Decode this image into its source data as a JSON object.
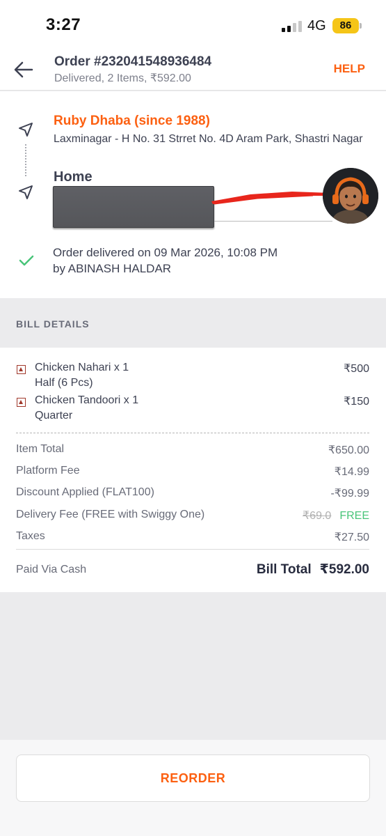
{
  "status_bar": {
    "time": "3:27",
    "network": "4G",
    "battery": "86"
  },
  "header": {
    "order_title": "Order #232041548936484",
    "order_subtitle": "Delivered, 2 Items, ₹592.00",
    "help_label": "HELP"
  },
  "route": {
    "restaurant_name": "Ruby Dhaba (since 1988)",
    "restaurant_address": "Laxminagar - H No. 31 Strret No. 4D Aram Park, Shastri Nagar",
    "home_label": "Home",
    "delivered_line1": "Order delivered on 09 Mar 2026, 10:08 PM",
    "delivered_line2": "by ABINASH HALDAR"
  },
  "bill": {
    "heading": "BILL DETAILS",
    "items": [
      {
        "name": "Chicken Nahari x 1",
        "variant": "Half (6 Pcs)",
        "price": "₹500"
      },
      {
        "name": "Chicken Tandoori x 1",
        "variant": "Quarter",
        "price": "₹150"
      }
    ],
    "item_total_label": "Item Total",
    "item_total": "₹650.00",
    "platform_fee_label": "Platform Fee",
    "platform_fee": "₹14.99",
    "discount_label": "Discount Applied (FLAT100)",
    "discount": "-₹99.99",
    "delivery_label": "Delivery Fee (FREE with Swiggy One)",
    "delivery_original": "₹69.0",
    "delivery_free": "FREE",
    "taxes_label": "Taxes",
    "taxes": "₹27.50",
    "paid_via": "Paid Via Cash",
    "bill_total_label": "Bill Total",
    "bill_total": "₹592.00"
  },
  "reorder_label": "REORDER",
  "colors": {
    "accent": "#fc6011",
    "success": "#48c479",
    "battery": "#f5c518"
  },
  "icons": [
    "signal-icon",
    "back-arrow-icon",
    "navigation-icon",
    "check-icon",
    "non-veg-icon"
  ]
}
